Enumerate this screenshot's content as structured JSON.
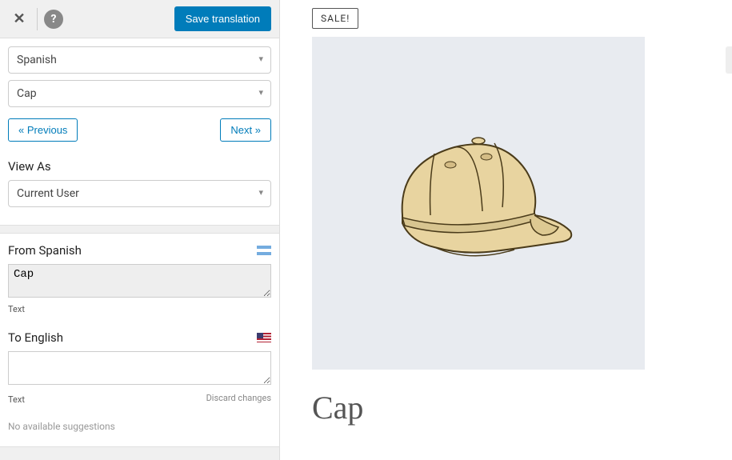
{
  "toolbar": {
    "save_label": "Save translation"
  },
  "language_select": "Spanish",
  "item_select": "Cap",
  "nav": {
    "prev": "« Previous",
    "next": "Next »"
  },
  "viewas": {
    "label": "View As",
    "value": "Current User"
  },
  "translation": {
    "from_label": "From Spanish",
    "source_value": "Cap",
    "source_type": "Text",
    "to_label": "To English",
    "target_value": "",
    "target_type": "Text",
    "discard": "Discard changes",
    "no_suggestions": "No available suggestions"
  },
  "product": {
    "sale_badge": "SALE!",
    "title": "Cap"
  },
  "icons": {
    "close": "✕",
    "help": "?",
    "zoom": "search-plus"
  }
}
